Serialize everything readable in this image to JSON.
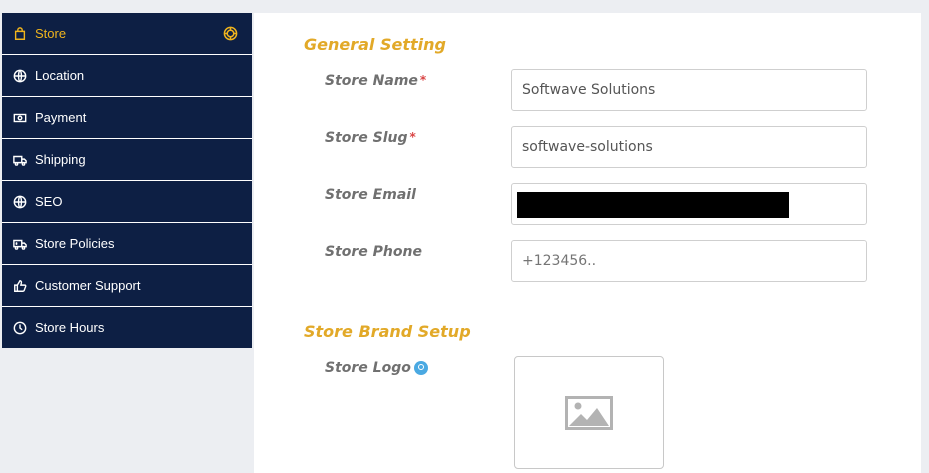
{
  "sidebar": {
    "items": [
      {
        "label": "Store",
        "icon": "bag-icon",
        "active": true
      },
      {
        "label": "Location",
        "icon": "globe-icon"
      },
      {
        "label": "Payment",
        "icon": "money-icon"
      },
      {
        "label": "Shipping",
        "icon": "truck-icon"
      },
      {
        "label": "SEO",
        "icon": "globe-icon"
      },
      {
        "label": "Store Policies",
        "icon": "policy-truck-icon"
      },
      {
        "label": "Customer Support",
        "icon": "thumbs-up-icon"
      },
      {
        "label": "Store Hours",
        "icon": "clock-icon"
      }
    ]
  },
  "general": {
    "title": "General Setting",
    "store_name": {
      "label": "Store Name",
      "required": "*",
      "value": "Softwave Solutions"
    },
    "store_slug": {
      "label": "Store Slug",
      "required": "*",
      "value": "softwave-solutions"
    },
    "store_email": {
      "label": "Store Email",
      "value": ""
    },
    "store_phone": {
      "label": "Store Phone",
      "placeholder": "+123456.."
    }
  },
  "brand": {
    "title": "Store Brand Setup",
    "logo_label": "Store Logo"
  },
  "colors": {
    "sidebar_bg": "#0d1f44",
    "accent": "#f0b41d",
    "section_title": "#e2a928",
    "required": "#d94545"
  }
}
